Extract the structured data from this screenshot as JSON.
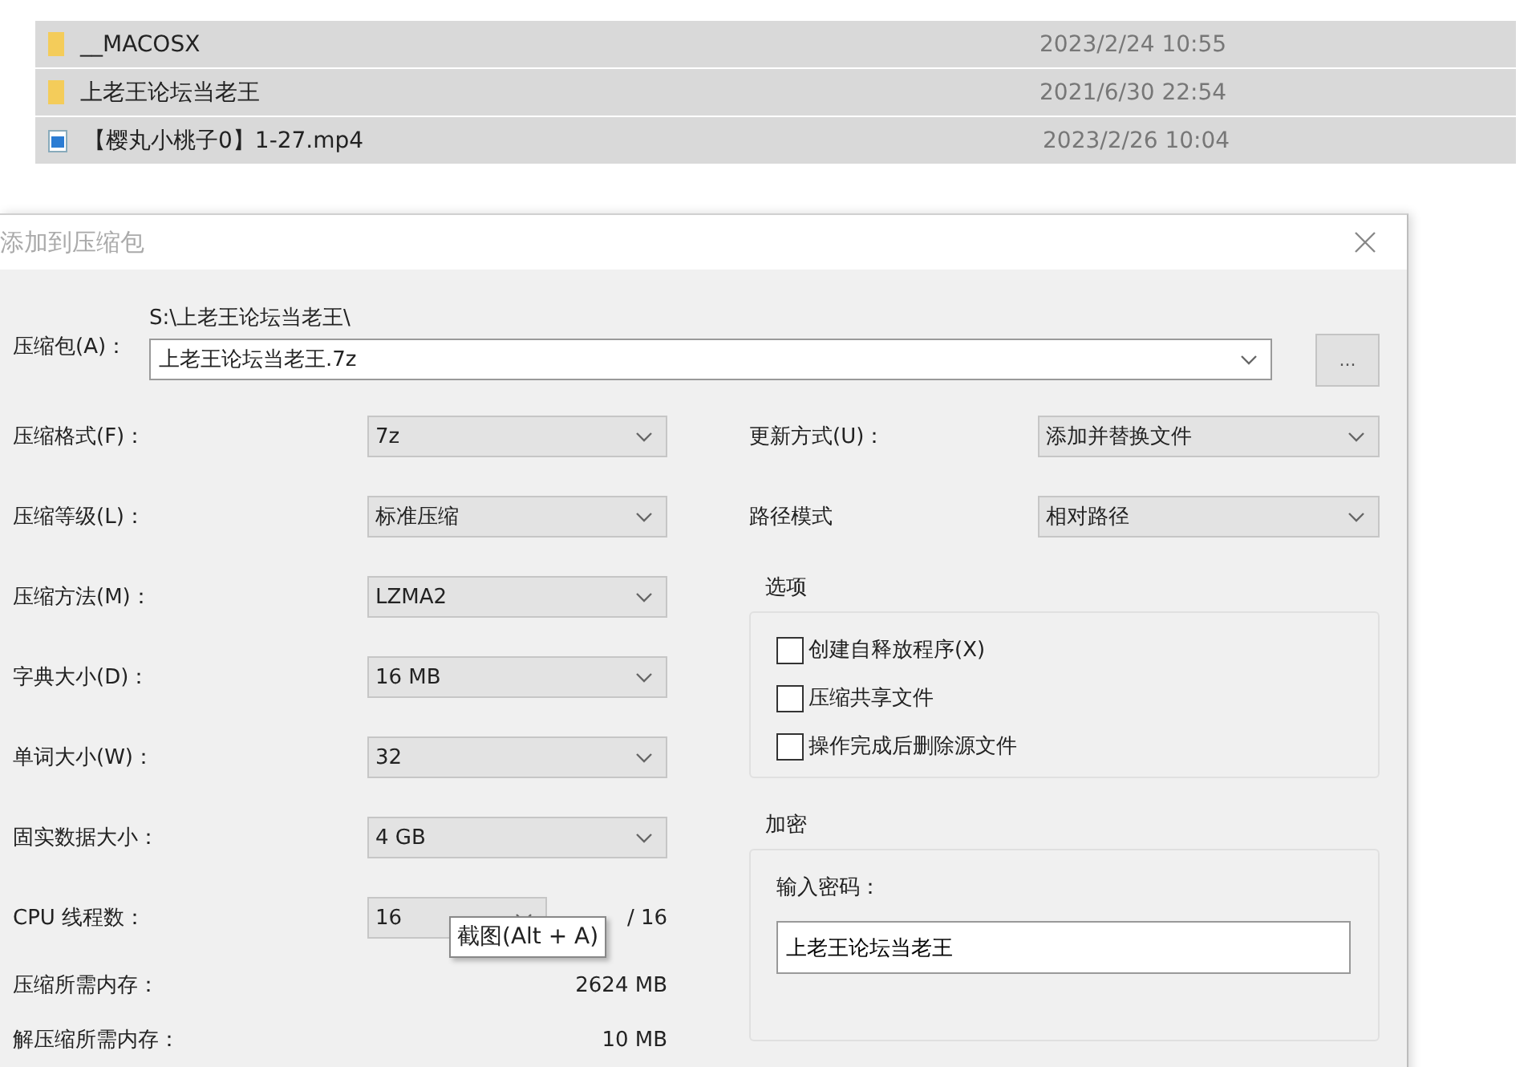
{
  "file_list": {
    "rows": [
      {
        "kind": "folder",
        "name": "__MACOSX",
        "modified": "2023/2/24 10:55",
        "selected": true
      },
      {
        "kind": "folder",
        "name": "上老王论坛当老王",
        "modified": "2021/6/30 22:54",
        "selected": true
      },
      {
        "kind": "video",
        "name": "【樱丸小桃子0】1-27.mp4",
        "modified": "2023/2/26 10:04",
        "selected": true
      }
    ]
  },
  "dialog": {
    "title": "添加到压缩包",
    "archive": {
      "label": "压缩包(A)：",
      "path": "S:\\上老王论坛当老王\\",
      "value": "上老王论坛当老王.7z",
      "browse_button": "..."
    },
    "left_fields": [
      {
        "kind": "select",
        "label": "压缩格式(F)：",
        "value": "7z"
      },
      {
        "kind": "select",
        "label": "压缩等级(L)：",
        "value": "标准压缩"
      },
      {
        "kind": "select",
        "label": "压缩方法(M)：",
        "value": "LZMA2"
      },
      {
        "kind": "select",
        "label": "字典大小(D)：",
        "value": "16 MB"
      },
      {
        "kind": "select",
        "label": "单词大小(W)：",
        "value": "32"
      },
      {
        "kind": "select",
        "label": "固实数据大小：",
        "value": "4 GB"
      },
      {
        "kind": "threads",
        "label": "CPU 线程数：",
        "value": "16",
        "suffix": "/ 16",
        "tooltip": "截图(Alt + A)"
      },
      {
        "kind": "info",
        "label": "压缩所需内存：",
        "value": "2624 MB"
      },
      {
        "kind": "info",
        "label": "解压缩所需内存：",
        "value": "10 MB"
      }
    ],
    "right_fields": [
      {
        "label": "更新方式(U)：",
        "value": "添加并替换文件"
      },
      {
        "label": "路径模式",
        "value": "相对路径"
      }
    ],
    "options": {
      "title": "选项",
      "items": [
        {
          "label": "创建自释放程序(X)",
          "checked": false
        },
        {
          "label": "压缩共享文件",
          "checked": false
        },
        {
          "label": "操作完成后删除源文件",
          "checked": false
        }
      ]
    },
    "encryption": {
      "title": "加密",
      "password_label": "输入密码：",
      "password": "上老王论坛当老王"
    }
  }
}
